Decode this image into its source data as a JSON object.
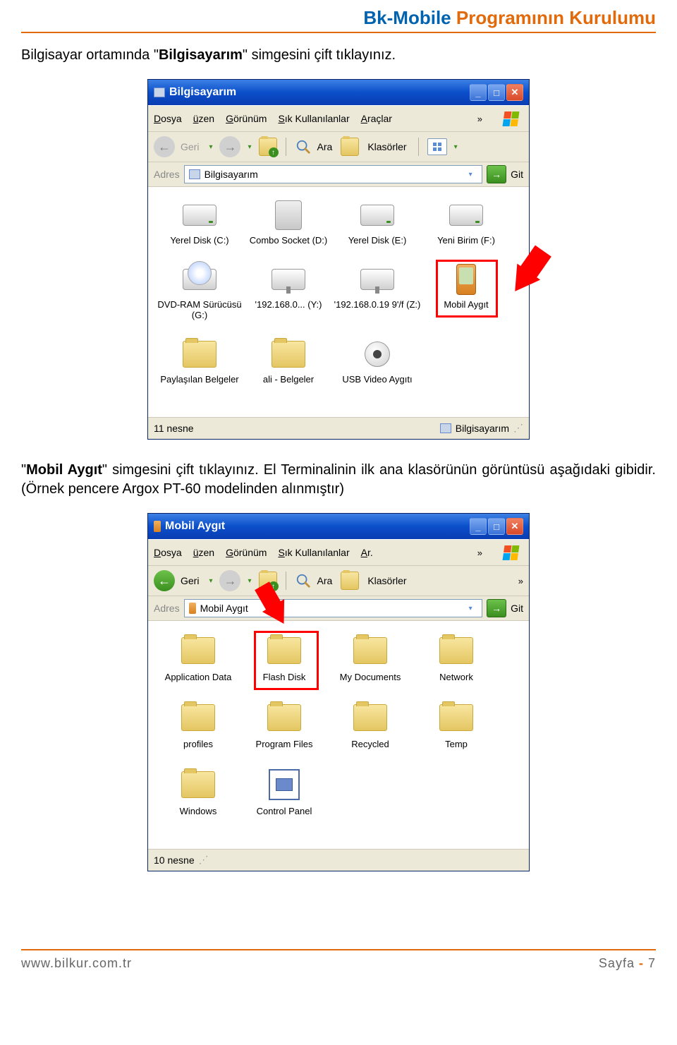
{
  "header": {
    "title_blue": "Bk-Mobile",
    "title_orange": "Programının Kurulumu"
  },
  "para1": {
    "pre": "Bilgisayar ortamında \"",
    "bold": "Bilgisayarım",
    "post": "\" simgesini çift tıklayınız."
  },
  "para2": {
    "pre": "\"",
    "bold": "Mobil Aygıt",
    "post": "\" simgesini çift tıklayınız. El Terminalinin ilk ana klasörünün görüntüsü aşağıdaki gibidir. (Örnek pencere Argox PT-60 modelinden alınmıştır)"
  },
  "win1": {
    "title": "Bilgisayarım",
    "menu": [
      "Dosya",
      "Düzen",
      "Görünüm",
      "Sık Kullanılanlar",
      "Araçlar"
    ],
    "toolbar": {
      "back": "Geri",
      "search": "Ara",
      "folders": "Klasörler"
    },
    "address_label": "Adres",
    "address_value": "Bilgisayarım",
    "go": "Git",
    "items": [
      "Yerel Disk (C:)",
      "Combo Socket (D:)",
      "Yerel Disk (E:)",
      "Yeni Birim (F:)",
      "DVD-RAM Sürücüsü (G:)",
      "'192.168.0... (Y:)",
      "'192.168.0.19 9'/f (Z:)",
      "Mobil Aygıt",
      "Paylaşılan Belgeler",
      "ali - Belgeler",
      "USB Video Aygıtı"
    ],
    "status_left": "11 nesne",
    "status_right": "Bilgisayarım"
  },
  "win2": {
    "title": "Mobil Aygıt",
    "menu": [
      "Dosya",
      "Düzen",
      "Görünüm",
      "Sık Kullanılanlar",
      "Ar."
    ],
    "toolbar": {
      "back": "Geri",
      "search": "Ara",
      "folders": "Klasörler"
    },
    "address_label": "Adres",
    "address_value": "Mobil Aygıt",
    "go": "Git",
    "items": [
      "Application Data",
      "Flash Disk",
      "My Documents",
      "Network",
      "profiles",
      "Program Files",
      "Recycled",
      "Temp",
      "Windows",
      "Control Panel"
    ],
    "status_left": "10 nesne"
  },
  "footer": {
    "left": "www.bilkur.com.tr",
    "right_label": "Sayfa",
    "right_sep": "-",
    "right_num": "7"
  }
}
